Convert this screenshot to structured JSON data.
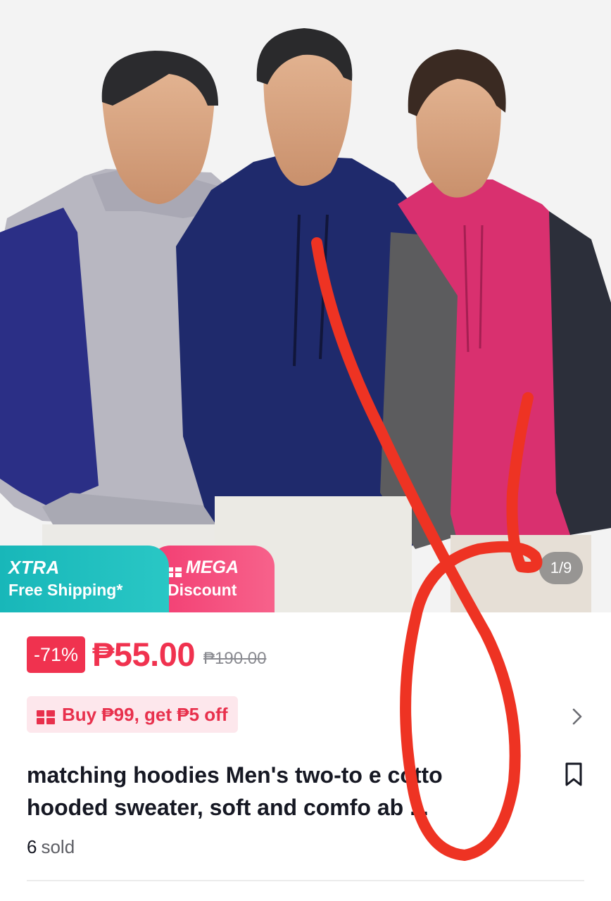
{
  "gallery": {
    "counter": "1/9"
  },
  "banners": {
    "xtra_title": "XTRA",
    "xtra_sub": "Free Shipping*",
    "mega_title": "MEGA",
    "mega_sub": "Discount"
  },
  "price": {
    "discount": "-71%",
    "current": "₱55.00",
    "original": "₱190.00"
  },
  "voucher": {
    "text": "Buy ₱99, get ₱5 off"
  },
  "product": {
    "title_line1": "matching hoodies Men's two-to e cotto",
    "title_line2": "hooded sweater, soft and comfo ab ...",
    "sold_count": "6",
    "sold_label": "sold"
  },
  "colors": {
    "accent": "#f0324f",
    "xtra": "#1fbcbc",
    "mega": "#f54c7d"
  },
  "icons": [
    "voucher-icon",
    "chevron-right-icon",
    "bookmark-icon",
    "mega-icon"
  ]
}
